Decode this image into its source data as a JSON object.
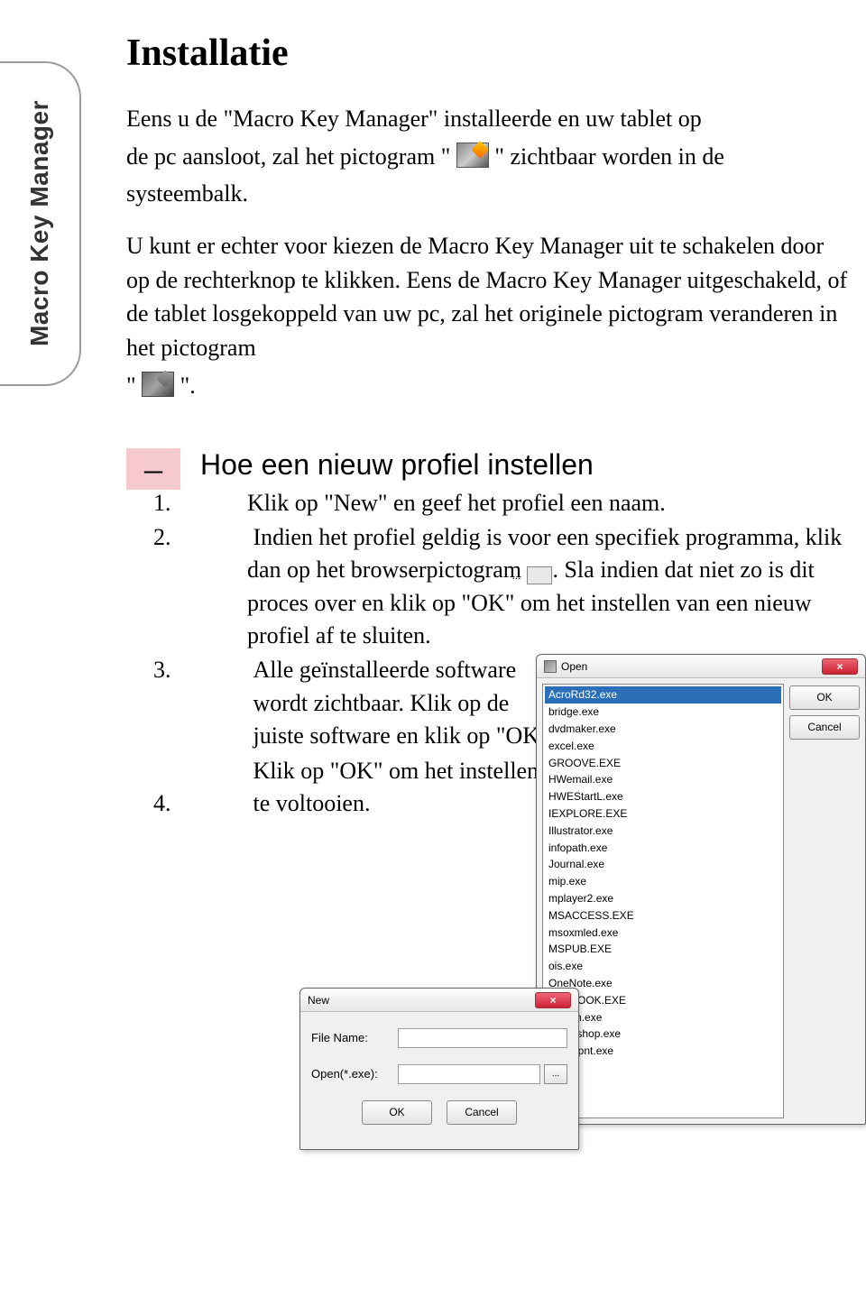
{
  "sidebar": {
    "label": "Macro Key Manager"
  },
  "title": "Installatie",
  "para": {
    "p1a": "Eens u de \"Macro Key Manager\" installeerde en uw tablet op",
    "p1b": "de pc aansloot, zal het pictogram \"",
    "p1c": "\" zichtbaar worden in de",
    "p2": "systeembalk.",
    "p3": "U kunt er echter voor kiezen de Macro Key Manager uit te schakelen door op de rechterknop te klikken. Eens de Macro Key Manager uitgeschakeld, of de tablet losgekoppeld van uw pc, zal het originele pictogram veranderen in het pictogram",
    "p3q1": "\"",
    "p3q2": "\"."
  },
  "section": {
    "dash": "–",
    "heading": "Hoe een nieuw profiel instellen",
    "steps": {
      "s1": "Klik op \"New\" en geef het profiel een naam.",
      "s2a": "Indien het profiel geldig is voor een specifiek programma, klik dan op het browserpictogram ",
      "s2b": ". Sla indien dat niet zo is dit proces over en klik op \"OK\" om het instellen van een nieuw profiel af te sluiten.",
      "s3": "Alle geïnstalleerde software wordt zichtbaar. Klik op de juiste software en klik op \"OK\".",
      "s4": "Klik op \"OK\" om het instellen te voltooien."
    }
  },
  "openDialog": {
    "title": "Open",
    "ok": "OK",
    "cancel": "Cancel",
    "close": "×",
    "items": [
      "AcroRd32.exe",
      "bridge.exe",
      "dvdmaker.exe",
      "excel.exe",
      "GROOVE.EXE",
      "HWemail.exe",
      "HWEStartL.exe",
      "IEXPLORE.EXE",
      "Illustrator.exe",
      "infopath.exe",
      "Journal.exe",
      "mip.exe",
      "mplayer2.exe",
      "MSACCESS.EXE",
      "msoxmled.exe",
      "MSPUB.EXE",
      "ois.exe",
      "OneNote.exe",
      "OUTLOOK.EXE",
      "pbrush.exe",
      "Photoshop.exe",
      "powerpnt.exe"
    ],
    "selectedIndex": 0
  },
  "newDialog": {
    "title": "New",
    "close": "×",
    "fileNameLabel": "File Name:",
    "openExeLabel": "Open(*.exe):",
    "browse": "...",
    "ok": "OK",
    "cancel": "Cancel"
  }
}
